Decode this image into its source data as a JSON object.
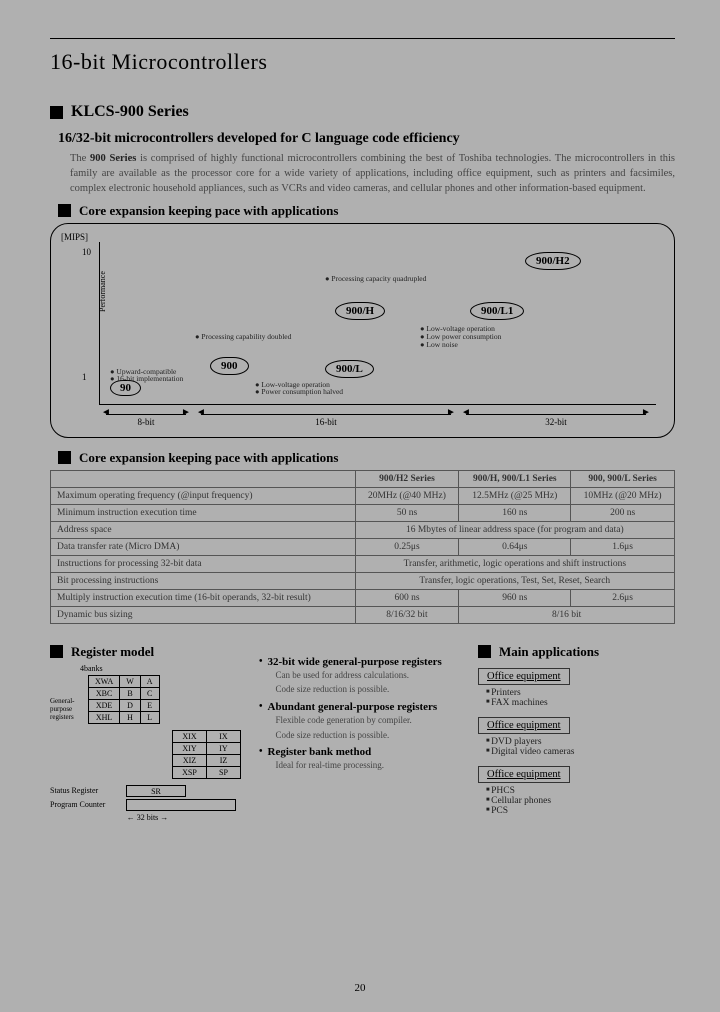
{
  "title": "16-bit Microcontrollers",
  "series_head": "KLCS-900 Series",
  "intro_head": "16/32-bit microcontrollers developed for C language code efficiency",
  "intro_body_pre": "The ",
  "intro_body_bold": "900 Series",
  "intro_body_post": " is comprised of highly functional microcontrollers combining the best of Toshiba technologies. The microcontrollers in this family are available as the processor core for a wide variety of applications, including office equipment, such as printers and facsimiles, complex electronic household appliances, such as VCRs and video cameras, and cellular phones and other information-based equipment.",
  "expand_head": "Core expansion keeping pace with applications",
  "chart_data": {
    "type": "scatter",
    "ylabel_top": "[MIPS]",
    "ylabel_side": "Performance",
    "y_ticks": [
      "1",
      "10"
    ],
    "x_segments": [
      "8-bit",
      "16-bit",
      "32-bit"
    ],
    "nodes": [
      {
        "label": "90"
      },
      {
        "label": "900"
      },
      {
        "label": "900/H"
      },
      {
        "label": "900/L"
      },
      {
        "label": "900/L1"
      },
      {
        "label": "900/H2"
      }
    ],
    "annotations": [
      "Upward-compatible",
      "16-bit implementation",
      "Processing capability doubled",
      "Low-voltage operation",
      "Power consumption halved",
      "Processing capacity quadrupled",
      "Low-voltage operation",
      "Low power consumption",
      "Low noise"
    ]
  },
  "table2_head": "Core expansion keeping pace with applications",
  "table": {
    "cols": [
      "",
      "900/H2 Series",
      "900/H, 900/L1 Series",
      "900, 900/L Series"
    ],
    "rows": [
      [
        "Maximum operating frequency (@input frequency)",
        "20MHz (@40 MHz)",
        "12.5MHz (@25 MHz)",
        "10MHz (@20 MHz)"
      ],
      [
        "Minimum instruction execution time",
        "50 ns",
        "160 ns",
        "200 ns"
      ],
      [
        "Address space",
        {
          "span": 3,
          "v": "16 Mbytes of linear address space (for program and data)"
        }
      ],
      [
        "Data transfer rate (Micro DMA)",
        "0.25μs",
        "0.64μs",
        "1.6μs"
      ],
      [
        "Instructions for processing 32-bit data",
        {
          "span": 3,
          "v": "Transfer, arithmetic, logic operations and shift instructions"
        }
      ],
      [
        "Bit processing instructions",
        {
          "span": 3,
          "v": "Transfer, logic operations, Test, Set, Reset, Search"
        }
      ],
      [
        "Multiply instruction execution time (16-bit operands, 32-bit result)",
        "600 ns",
        "960 ns",
        "2.6μs"
      ],
      [
        "Dynamic bus sizing",
        "8/16/32 bit",
        {
          "span": 2,
          "v": "8/16 bit"
        }
      ]
    ]
  },
  "reg_head": "Register model",
  "reg": {
    "banks": "4banks",
    "rows4": [
      [
        "XWA",
        "W",
        "A"
      ],
      [
        "XBC",
        "B",
        "C"
      ],
      [
        "XDE",
        "D",
        "E"
      ],
      [
        "XHL",
        "H",
        "L"
      ]
    ],
    "gp_label": "General-purpose registers",
    "rows2": [
      [
        "XIX",
        "IX"
      ],
      [
        "XIY",
        "IY"
      ],
      [
        "XIZ",
        "IZ"
      ],
      [
        "XSP",
        "SP"
      ]
    ],
    "sr_label": "Status Register",
    "sr": "SR",
    "pc_label": "Program Counter",
    "width": "32 bits"
  },
  "features": [
    {
      "t": "32-bit wide general-purpose registers",
      "d": [
        "Can be used for address calculations.",
        "Code size reduction is possible."
      ]
    },
    {
      "t": "Abundant general-purpose registers",
      "d": [
        "Flexible code generation by compiler.",
        "Code size reduction is possible."
      ]
    },
    {
      "t": "Register bank method",
      "d": [
        "Ideal for real-time processing."
      ]
    }
  ],
  "apps_head": "Main applications",
  "apps": [
    {
      "box": "Office equipment",
      "items": [
        "Printers",
        "FAX machines"
      ]
    },
    {
      "box": "Office equipment",
      "items": [
        "DVD players",
        "Digital video cameras"
      ]
    },
    {
      "box": "Office equipment",
      "items": [
        "PHCS",
        "Cellular phones",
        "PCS"
      ]
    }
  ],
  "page_num": "20"
}
